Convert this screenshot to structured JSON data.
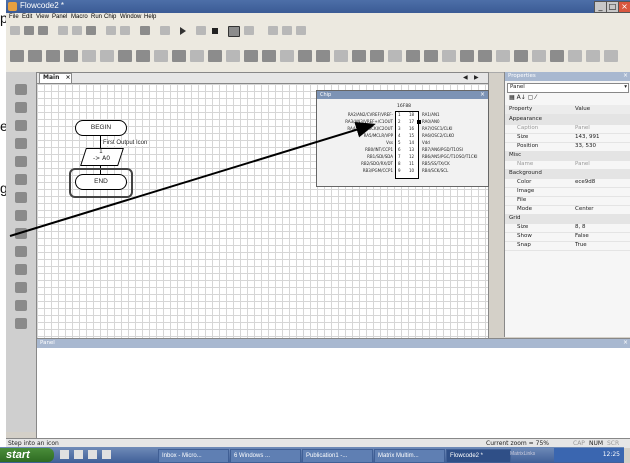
{
  "doc_fragments": [
    "p",
    "e",
    "g"
  ],
  "app": {
    "title": "Flowcode2 *",
    "menu": [
      "File",
      "Edit",
      "View",
      "Panel",
      "Macro",
      "Run",
      "Chip",
      "Window",
      "Help"
    ]
  },
  "main_window": {
    "tab": "Main",
    "flowchart": {
      "begin": "BEGIN",
      "output_name": "First Output Icon",
      "output_line1": "1",
      "output_line2": "-> A0",
      "end": "END"
    }
  },
  "chip_window": {
    "title": "Chip",
    "chip_name": "16F88",
    "left_pins": [
      "RA2/AN2/CVREF/VREF-",
      "RA3/AN3/VREF+/C1OUT",
      "RA4/AN4/T0CKI/C2OUT",
      "RA5/MCLR/VPP",
      "Vss",
      "RB0/INT/CCP1",
      "RB1/SDI/SDA",
      "RB2/SDO/RX/DT",
      "RB3/PGM/CCP1"
    ],
    "right_pins": [
      "RA1/AN1",
      "RA0/AN0",
      "RA7/OSC1/CLKI",
      "RA6/OSC2/CLKO",
      "Vdd",
      "RB7/AN6/PGD/T1OSI",
      "RB6/AN5/PGC/T1OSO/T1CKI",
      "RB5/SS/TX/CK",
      "RB4/SCK/SCL"
    ],
    "left_pin_numbers": [
      "1",
      "2",
      "3",
      "4",
      "5",
      "6",
      "7",
      "8",
      "9"
    ],
    "right_pin_numbers": [
      "18",
      "17",
      "16",
      "15",
      "14",
      "13",
      "12",
      "11",
      "10"
    ]
  },
  "properties": {
    "title": "Properties",
    "selected": "Panel",
    "col_property": "Property",
    "col_value": "Value",
    "rows": [
      {
        "k": "Appearance",
        "v": "",
        "cat": true
      },
      {
        "k": "Caption",
        "v": "Panel",
        "grey": true
      },
      {
        "k": "Size",
        "v": "143, 991"
      },
      {
        "k": "Position",
        "v": "33, 530"
      },
      {
        "k": "Misc",
        "v": "",
        "cat": true
      },
      {
        "k": "Name",
        "v": "Panel",
        "grey": true
      },
      {
        "k": "Background",
        "v": "",
        "cat": true
      },
      {
        "k": "Color",
        "v": "ece9d8"
      },
      {
        "k": "Image",
        "v": ""
      },
      {
        "k": "File",
        "v": ""
      },
      {
        "k": "Mode",
        "v": "Center"
      },
      {
        "k": "Grid",
        "v": "",
        "cat": true
      },
      {
        "k": "Size",
        "v": "8, 8"
      },
      {
        "k": "Show",
        "v": "False"
      },
      {
        "k": "Snap",
        "v": "True"
      }
    ]
  },
  "panel": {
    "title": "Panel"
  },
  "status": {
    "left": "Step into an icon",
    "zoom": "Current zoom = 75%",
    "caps": "CAP",
    "num": "NUM",
    "scrl": "SCR"
  },
  "taskbar": {
    "start": "start",
    "tasks": [
      "Inbox - Micro...",
      "6 Windows ...",
      "Publication1 -...",
      "Matrix Multim...",
      "Flowcode2 *",
      "MatrixLinks"
    ],
    "clock": "12:25"
  },
  "colors": {
    "titlebar": "#3b5b95",
    "taskbar": "#3f5f98",
    "start": "#2e6b22",
    "annotation_arrow": "#000000"
  }
}
